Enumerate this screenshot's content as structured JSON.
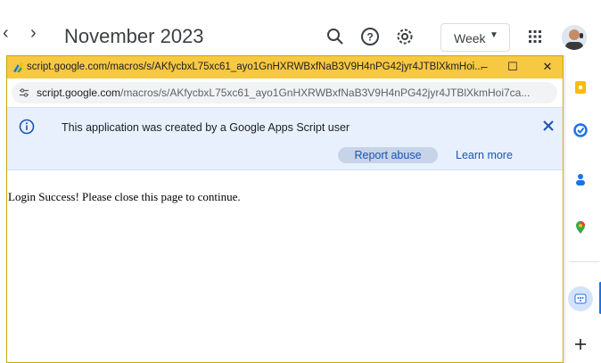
{
  "calendar": {
    "month_title": "November 2023",
    "view_selector": "Week",
    "icons": [
      "chevron-left-icon",
      "chevron-right-icon",
      "search-icon",
      "help-icon",
      "settings-icon",
      "apps-grid-icon"
    ]
  },
  "side_panel": {
    "icons": [
      "keep-icon",
      "tasks-icon",
      "contacts-icon",
      "maps-icon",
      "add-icon"
    ]
  },
  "popup": {
    "window_title": "script.google.com/macros/s/AKfycbxL75xc61_ayo1GnHXRWBxfNaB3V9H4nPG42jyr4JTBlXkmHoi...",
    "controls": {
      "minimize": "–",
      "maximize": "☐",
      "close": "✕"
    },
    "address": {
      "host": "script.google.com",
      "path": "/macros/s/AKfycbxL75xc61_ayo1GnHXRWBxfNaB3V9H4nPG42jyr4JTBlXkmHoi7ca..."
    },
    "infobar": {
      "message": "This application was created by a Google Apps Script user",
      "report_label": "Report abuse",
      "learn_label": "Learn more"
    },
    "content": {
      "message": "Login Success! Please close this page to continue."
    }
  }
}
